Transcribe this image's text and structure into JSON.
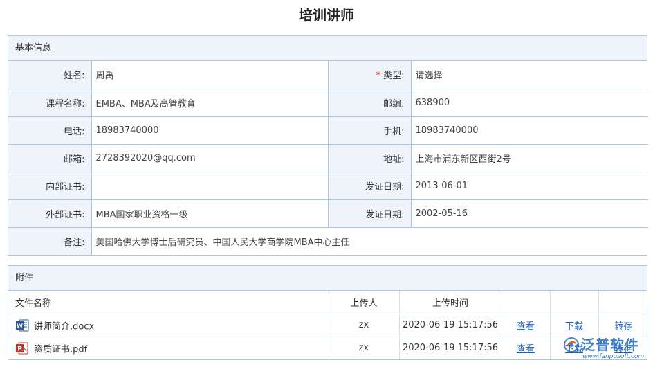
{
  "title": "培训讲师",
  "basic": {
    "header": "基本信息",
    "rows": [
      [
        {
          "label": "姓名:",
          "value": "周禹"
        },
        {
          "label": "类型:",
          "value": "请选择",
          "required": "*"
        }
      ],
      [
        {
          "label": "课程名称:",
          "value": "EMBA、MBA及高管教育"
        },
        {
          "label": "邮编:",
          "value": "638900"
        }
      ],
      [
        {
          "label": "电话:",
          "value": "18983740000"
        },
        {
          "label": "手机:",
          "value": "18983740000"
        }
      ],
      [
        {
          "label": "邮箱:",
          "value": "2728392020@qq.com"
        },
        {
          "label": "地址:",
          "value": "上海市浦东新区西街2号"
        }
      ],
      [
        {
          "label": "内部证书:",
          "value": ""
        },
        {
          "label": "发证日期:",
          "value": "2013-06-01"
        }
      ],
      [
        {
          "label": "外部证书:",
          "value": "MBA国家职业资格一级"
        },
        {
          "label": "发证日期:",
          "value": "2002-05-16"
        }
      ],
      [
        {
          "label": "备注:",
          "value": "美国哈佛大学博士后研究员、中国人民大学商学院MBA中心主任"
        }
      ]
    ]
  },
  "attachments": {
    "header": "附件",
    "columns": [
      "文件名称",
      "上传人",
      "上传时间",
      "",
      "",
      ""
    ],
    "rows": [
      {
        "icon": "word-doc-icon",
        "name": "讲师简介.docx",
        "uploader": "zx",
        "time": "2020-06-19 15:17:56",
        "view": "查看",
        "download": "下载",
        "save": "转存"
      },
      {
        "icon": "pdf-doc-icon",
        "name": "资质证书.pdf",
        "uploader": "zx",
        "time": "2020-06-19 15:17:56",
        "view": "查看",
        "download": "下载",
        "save": "转存"
      }
    ]
  },
  "watermark": {
    "text": "泛普软件",
    "url": "www.fanpusoft.com"
  },
  "colors": {
    "border": "#a9c6de",
    "label_bg": "#eef4fa",
    "link": "#1a5fb4",
    "required": "#e02020",
    "word": "#2b5797",
    "pdf": "#c0392b"
  }
}
